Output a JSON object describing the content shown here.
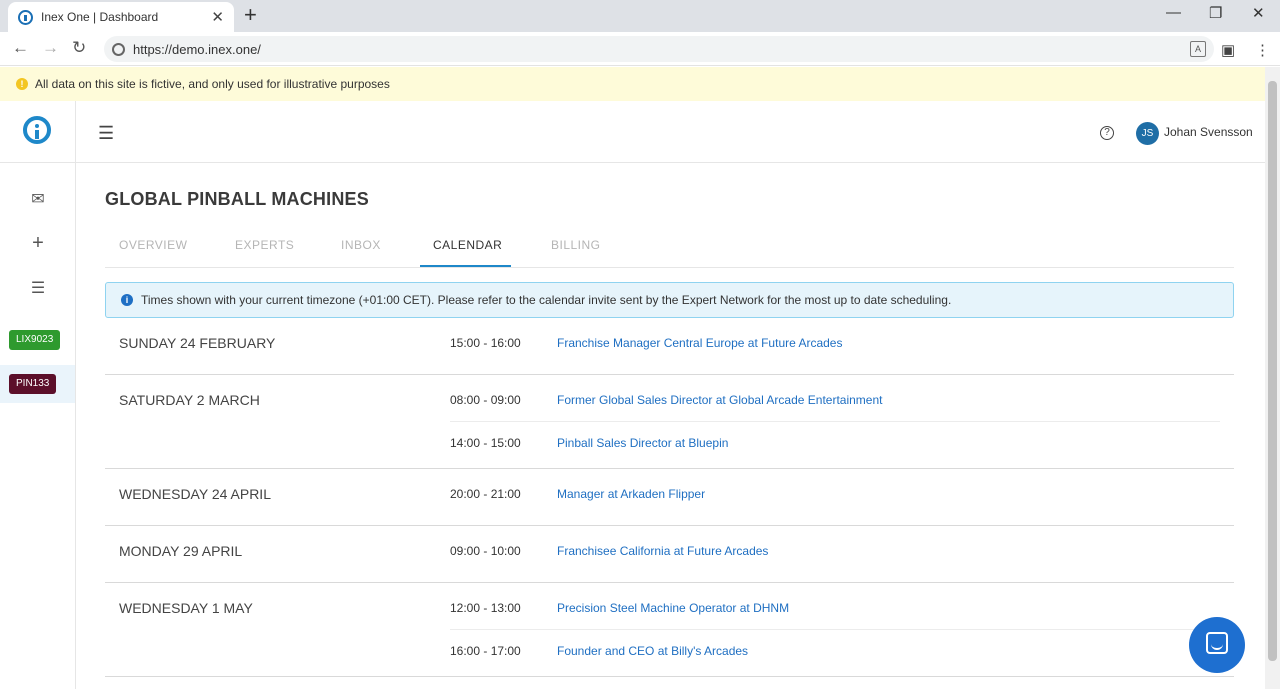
{
  "browser": {
    "tab_title": "Inex One | Dashboard",
    "url": "https://demo.inex.one/"
  },
  "notice": {
    "text": "All data on this site is fictive, and only used for illustrative purposes"
  },
  "sidebar": {
    "projects": [
      {
        "code": "LIX9023",
        "color": "#2e9a2e"
      },
      {
        "code": "PIN133",
        "color": "#5c0f2a"
      }
    ]
  },
  "header": {
    "user_initials": "JS",
    "user_name": "Johan Svensson"
  },
  "page": {
    "title": "GLOBAL PINBALL MACHINES",
    "tabs": [
      {
        "label": "OVERVIEW",
        "active": false
      },
      {
        "label": "EXPERTS",
        "active": false
      },
      {
        "label": "INBOX",
        "active": false
      },
      {
        "label": "CALENDAR",
        "active": true
      },
      {
        "label": "BILLING",
        "active": false
      }
    ],
    "info": "Times shown with your current timezone (+01:00 CET). Please refer to the calendar invite sent by the Expert Network for the most up to date scheduling."
  },
  "calendar": [
    {
      "day": "SUNDAY 24 FEBRUARY",
      "events": [
        {
          "time": "15:00 - 16:00",
          "title": "Franchise Manager Central Europe at Future Arcades"
        }
      ]
    },
    {
      "day": "SATURDAY 2 MARCH",
      "events": [
        {
          "time": "08:00 - 09:00",
          "title": "Former Global Sales Director at Global Arcade Entertainment"
        },
        {
          "time": "14:00 - 15:00",
          "title": "Pinball Sales Director at Bluepin"
        }
      ]
    },
    {
      "day": "WEDNESDAY 24 APRIL",
      "events": [
        {
          "time": "20:00 - 21:00",
          "title": "Manager at Arkaden Flipper"
        }
      ]
    },
    {
      "day": "MONDAY 29 APRIL",
      "events": [
        {
          "time": "09:00 - 10:00",
          "title": "Franchisee California at Future Arcades"
        }
      ]
    },
    {
      "day": "WEDNESDAY 1 MAY",
      "events": [
        {
          "time": "12:00 - 13:00",
          "title": "Precision Steel Machine Operator at DHNM"
        },
        {
          "time": "16:00 - 17:00",
          "title": "Founder and CEO at Billy's Arcades"
        }
      ]
    }
  ]
}
